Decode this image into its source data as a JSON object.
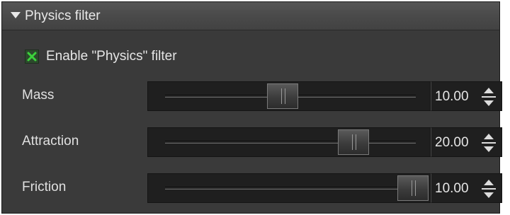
{
  "panel": {
    "title": "Physics filter",
    "expanded_icon": "triangle-down-icon"
  },
  "enable": {
    "label": "Enable \"Physics\" filter",
    "checked": true,
    "check_icon": "x-check-icon",
    "check_color": "#3cd23c"
  },
  "params": [
    {
      "label": "Mass",
      "value": "10.00",
      "slider_fraction": 0.47
    },
    {
      "label": "Attraction",
      "value": "20.00",
      "slider_fraction": 0.75
    },
    {
      "label": "Friction",
      "value": "10.00",
      "slider_fraction": 0.99
    }
  ],
  "colors": {
    "panel_bg": "#3a3a3a",
    "control_bg": "#1f1f1f",
    "text": "#e6e6e6"
  }
}
